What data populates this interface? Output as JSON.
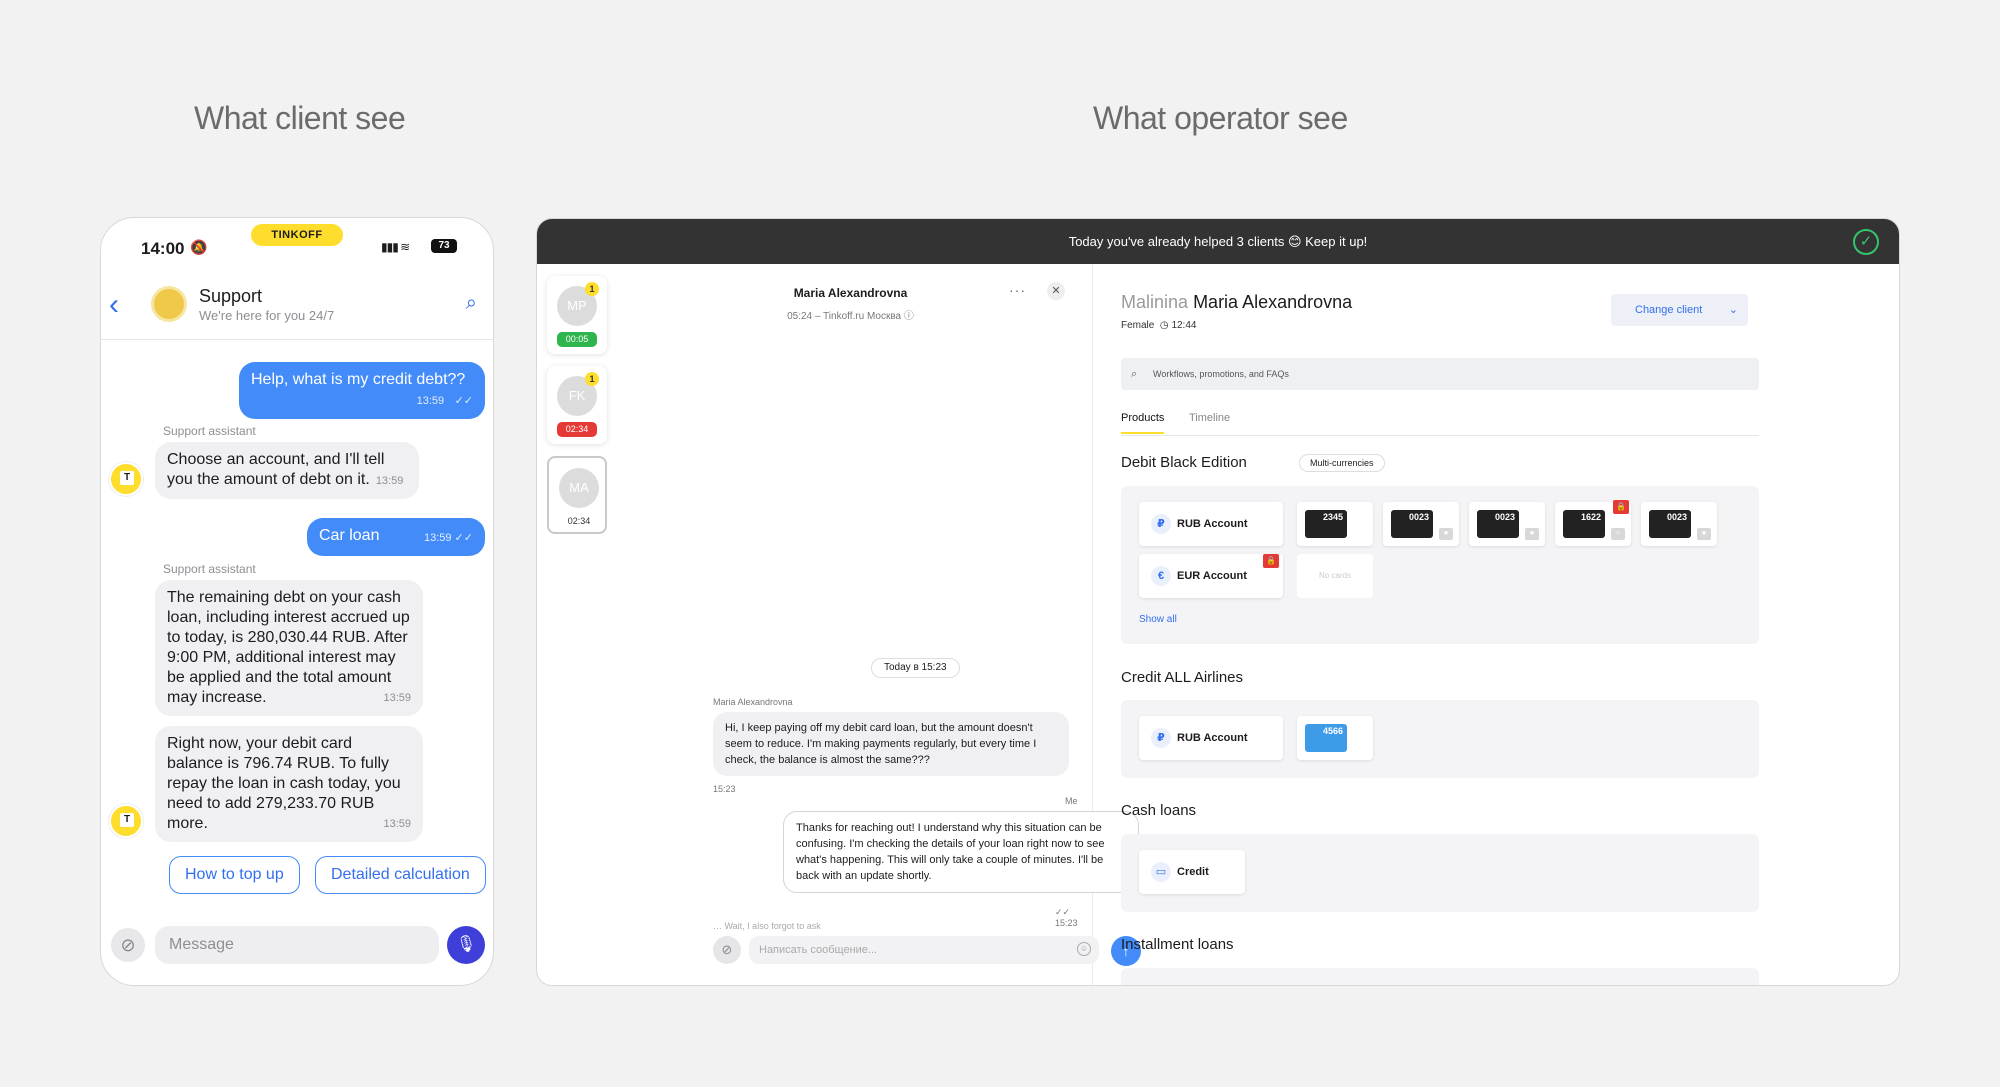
{
  "headings": {
    "client": "What client see",
    "operator": "What operator see"
  },
  "phone": {
    "time": "14:00",
    "brand": "TINKOFF",
    "battery": "73",
    "header": {
      "title": "Support",
      "subtitle": "We're here for you 24/7"
    },
    "messages": [
      {
        "from": "client",
        "text": "Help, what is my credit debt??",
        "time": "13:59"
      },
      {
        "from": "support",
        "sender": "Support assistant",
        "text": "Choose an account, and I'll tell you the amount of debt on it.",
        "time": "13:59"
      },
      {
        "from": "client",
        "text": "Car loan",
        "time": "13:59"
      },
      {
        "from": "support",
        "sender": "Support assistant",
        "text": "The remaining debt on your cash loan, including interest accrued up to today, is 280,030.44 RUB. After 9:00 PM, additional interest may be applied and the total amount may increase.",
        "time": "13:59"
      },
      {
        "from": "support",
        "text": "Right now, your debit card balance is 796.74 RUB. To fully repay the loan in cash today, you need to add 279,233.70 RUB more.",
        "time": "13:59"
      }
    ],
    "quick_replies": [
      "How to top up",
      "Detailed calculation"
    ],
    "composer_placeholder": "Message"
  },
  "operator": {
    "banner": "Today you've already helped 3 clients 😊 Keep it up!",
    "queue": [
      {
        "initials": "MP",
        "badge": "1",
        "time": "00:05",
        "color": "#2fb54d"
      },
      {
        "initials": "FK",
        "badge": "1",
        "time": "02:34",
        "color": "#e53935"
      },
      {
        "initials": "MA",
        "time": "02:34"
      }
    ],
    "chat": {
      "name": "Maria Alexandrovna",
      "subtitle": "05:24 – Tinkoff.ru Москва",
      "date_chip": "Today в 15:23",
      "client_sender": "Maria Alexandrovna",
      "client_msg": "Hi, I keep paying off my debit card loan, but the amount doesn't seem to reduce. I'm making payments regularly, but every time I check, the balance is almost the same???",
      "client_time": "15:23",
      "op_sender": "Me",
      "op_msg": "Thanks for reaching out! I understand why this situation can be confusing. I'm checking the details of your loan right now to see what's happening. This will only take a couple of minutes. I'll be back with an update shortly.",
      "op_time": "15:23",
      "typing": "Wait, I also forgot to ask",
      "placeholder": "Написать сообщение..."
    },
    "client": {
      "last_name": "Malinina",
      "name": "Maria Alexandrovna",
      "gender": "Female",
      "local_time": "12:44",
      "change_button": "Change client",
      "search_placeholder": "Workflows, promotions, and FAQs",
      "tabs": [
        "Products",
        "Timeline"
      ],
      "sections": {
        "debit": {
          "title": "Debit Black Edition",
          "tag": "Multi-currencies",
          "accounts": [
            "RUB Account",
            "EUR Account"
          ],
          "cards": [
            "2345",
            "0023",
            "0023",
            "1622",
            "0023"
          ],
          "no_cards": "No cards",
          "show_all": "Show all"
        },
        "credit": {
          "title": "Credit ALL Airlines",
          "account": "RUB Account",
          "card": "4566"
        },
        "cash": {
          "title": "Cash loans",
          "item": "Credit"
        },
        "installment": {
          "title": "Installment loans"
        }
      }
    }
  }
}
